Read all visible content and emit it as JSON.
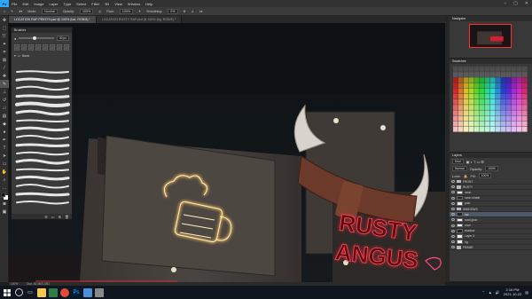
{
  "menubar": {
    "logo": "Ps",
    "items": [
      "File",
      "Edit",
      "Image",
      "Layer",
      "Type",
      "Select",
      "Filter",
      "3D",
      "View",
      "Window",
      "Help"
    ]
  },
  "options": {
    "mode_label": "Mode:",
    "mode_value": "Normal",
    "opacity_label": "Opacity:",
    "opacity_value": "100%",
    "flow_label": "Flow:",
    "flow_value": "100%",
    "smoothing_label": "Smoothing:",
    "smoothing_value": "0%"
  },
  "tabs": [
    {
      "label": "LOCATION RAP PRINTS.psd @ 100% (bar, RGB/8) *",
      "active": true
    },
    {
      "label": "LOCATION RUSTY RAP.psd @ 100% (bg, RGB/8) *",
      "active": false
    }
  ],
  "tools": [
    "move",
    "marquee",
    "lasso",
    "wand",
    "crop",
    "frame",
    "eyedropper",
    "heal",
    "brush",
    "stamp",
    "history",
    "eraser",
    "gradient",
    "blur",
    "dodge",
    "pen",
    "text",
    "path",
    "shape",
    "hand",
    "zoom",
    "more",
    "fg",
    "bg",
    "mask",
    "screen"
  ],
  "brushes": {
    "title": "Brushes",
    "size_value": "30 px",
    "group_name": "Basic",
    "stroke_count": 17
  },
  "navigator": {
    "title": "Navigator"
  },
  "swatches": {
    "title": "Swatches"
  },
  "layers": {
    "title": "Layers",
    "kind_label": "Kind",
    "blend_mode": "Normal",
    "opacity_label": "Opacity:",
    "opacity_value": "100%",
    "fill_label": "Fill:",
    "fill_value": "100%",
    "lock_label": "Lock:",
    "rows": [
      {
        "name": "FRONT",
        "type": "folder",
        "selected": false
      },
      {
        "name": "RUSTY",
        "type": "folder",
        "selected": false
      },
      {
        "name": "neon",
        "type": "layer",
        "selected": false
      },
      {
        "name": "neon shade",
        "type": "layer",
        "selected": false
      },
      {
        "name": "post",
        "type": "layer",
        "selected": false
      },
      {
        "name": "WINDOWS",
        "type": "folder",
        "selected": false
      },
      {
        "name": "bar",
        "type": "layer",
        "selected": true
      },
      {
        "name": "road glow",
        "type": "layer",
        "selected": false
      },
      {
        "name": "road",
        "type": "layer",
        "selected": false
      },
      {
        "name": "shadow",
        "type": "layer",
        "selected": false
      },
      {
        "name": "Layer 3",
        "type": "layer",
        "selected": false
      },
      {
        "name": "bg",
        "type": "layer",
        "selected": false
      },
      {
        "name": "FRAME",
        "type": "folder",
        "selected": false
      }
    ]
  },
  "status": {
    "zoom": "100%",
    "doc": "Doc: 46.4M/1.55G"
  },
  "canvas": {
    "sign_line1": "RUSTY",
    "sign_line2": "ANGUS"
  },
  "taskbar": {
    "time": "2:16 PM",
    "date": "2021-10-22"
  },
  "colors": {
    "neon_red": "#ff2b3a",
    "neon_yellow": "#ffd36a",
    "ps_blue": "#31a8ff",
    "selection": "#4d5a6a"
  }
}
